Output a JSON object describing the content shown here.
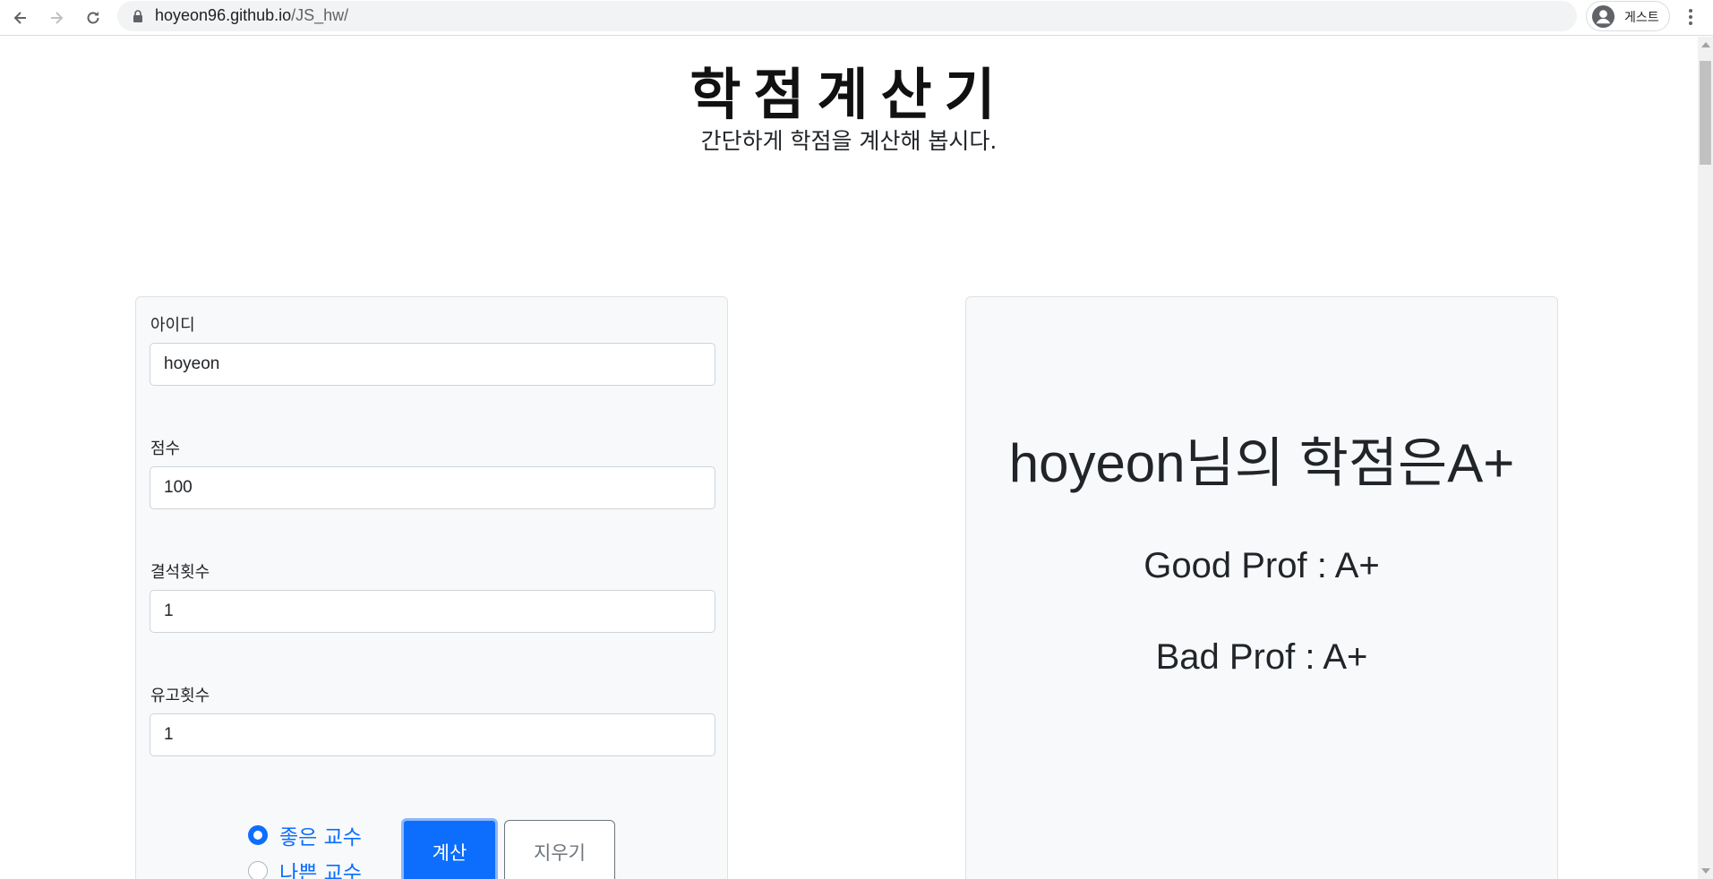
{
  "browser": {
    "url_host": "hoyeon96.github.io",
    "url_path": "/JS_hw/",
    "profile_label": "게스트"
  },
  "header": {
    "title": "학점계산기",
    "subtitle": "간단하게 학점을 계산해 봅시다."
  },
  "form": {
    "id_label": "아이디",
    "id_value": "hoyeon",
    "score_label": "점수",
    "score_value": "100",
    "absence_label": "결석횟수",
    "absence_value": "1",
    "late_label": "유고횟수",
    "late_value": "1",
    "radio_good": "좋은 교수",
    "radio_bad": "나쁜 교수",
    "selected_prof": "좋은 교수",
    "calc_button": "계산",
    "clear_button": "지우기"
  },
  "result": {
    "main": "hoyeon님의 학점은A+",
    "good_prof": "Good Prof : A+",
    "bad_prof": "Bad Prof : A+"
  },
  "colors": {
    "primary": "#0d6efd",
    "card_bg": "#f8f9fa"
  }
}
